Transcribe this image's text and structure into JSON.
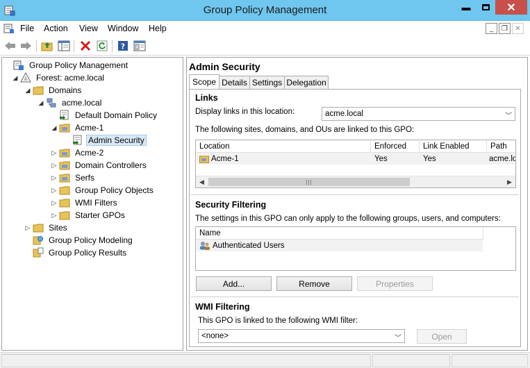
{
  "window": {
    "title": "Group Policy Management",
    "title_bar_color": "#6fc6ee",
    "minimize_icon": "minimize-icon",
    "maximize_icon": "maximize-icon",
    "close_icon": "close-icon"
  },
  "menu": {
    "items": [
      "File",
      "Action",
      "View",
      "Window",
      "Help"
    ]
  },
  "toolbar": {
    "icons": [
      "back-arrow-icon",
      "forward-arrow-icon",
      "up-folder-icon",
      "show-hide-tree-icon",
      "delete-icon",
      "refresh-icon",
      "help-icon",
      "properties-icon"
    ]
  },
  "tree": {
    "nodes": [
      {
        "label": "Group Policy Management",
        "icon": "gpm-root-icon",
        "expander": ""
      },
      {
        "label": "Forest: acme.local",
        "icon": "forest-icon",
        "expander": "◢"
      },
      {
        "label": "Domains",
        "icon": "folder-icon",
        "expander": "◢"
      },
      {
        "label": "acme.local",
        "icon": "domain-icon",
        "expander": "◢"
      },
      {
        "label": "Default Domain Policy",
        "icon": "gpo-link-icon",
        "expander": ""
      },
      {
        "label": "Acme-1",
        "icon": "ou-folder-icon",
        "expander": "◢"
      },
      {
        "label": "Admin Security",
        "icon": "gpo-link-icon",
        "expander": "",
        "selected": true
      },
      {
        "label": "Acme-2",
        "icon": "ou-folder-icon",
        "expander": "▷"
      },
      {
        "label": "Domain Controllers",
        "icon": "ou-folder-icon",
        "expander": "▷"
      },
      {
        "label": "Serfs",
        "icon": "ou-folder-icon",
        "expander": "▷"
      },
      {
        "label": "Group Policy Objects",
        "icon": "folder-icon",
        "expander": "▷"
      },
      {
        "label": "WMI Filters",
        "icon": "folder-icon",
        "expander": "▷"
      },
      {
        "label": "Starter GPOs",
        "icon": "folder-icon",
        "expander": "▷"
      },
      {
        "label": "Sites",
        "icon": "folder-icon",
        "expander": "▷"
      },
      {
        "label": "Group Policy Modeling",
        "icon": "modeling-icon",
        "expander": ""
      },
      {
        "label": "Group Policy Results",
        "icon": "results-icon",
        "expander": ""
      }
    ]
  },
  "details": {
    "title": "Admin Security",
    "tabs": [
      "Scope",
      "Details",
      "Settings",
      "Delegation"
    ],
    "active_tab": "Scope",
    "links": {
      "heading": "Links",
      "display_label": "Display links in this location:",
      "location_value": "acme.local",
      "description": "The following sites, domains, and OUs are linked to this GPO:",
      "columns": [
        "Location",
        "Enforced",
        "Link Enabled",
        "Path"
      ],
      "rows": [
        {
          "location": "Acme-1",
          "enforced": "Yes",
          "link_enabled": "Yes",
          "path": "acme.lo"
        }
      ]
    },
    "security": {
      "heading": "Security Filtering",
      "description": "The settings in this GPO can only apply to the following groups, users, and computers:",
      "column": "Name",
      "rows": [
        "Authenticated Users"
      ],
      "add_label": "Add...",
      "remove_label": "Remove",
      "properties_label": "Properties"
    },
    "wmi": {
      "heading": "WMI Filtering",
      "description": "This GPO is linked to the following WMI filter:",
      "filter_value": "<none>",
      "open_label": "Open"
    }
  }
}
